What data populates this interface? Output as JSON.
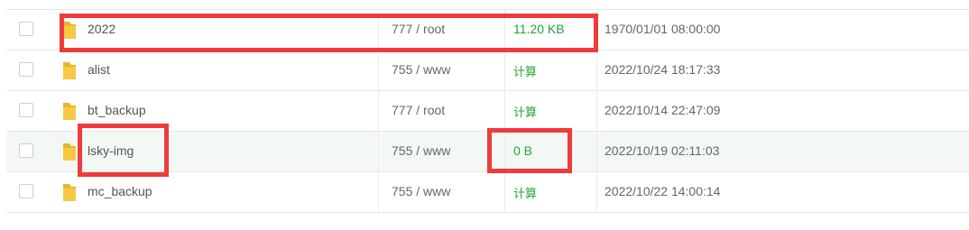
{
  "colors": {
    "size_green": "#20a53a",
    "highlight_red": "#ee3b3b",
    "folder_yellow": "#f6c945"
  },
  "rows": [
    {
      "name": "2022",
      "permission": "777 / root",
      "size": "11.20 KB",
      "modified": "1970/01/01 08:00:00"
    },
    {
      "name": "alist",
      "permission": "755 / www",
      "size": "计算",
      "modified": "2022/10/24 18:17:33"
    },
    {
      "name": "bt_backup",
      "permission": "777 / root",
      "size": "计算",
      "modified": "2022/10/14 22:47:09"
    },
    {
      "name": "lsky-img",
      "permission": "755 / www",
      "size": "0 B",
      "modified": "2022/10/19 02:11:03"
    },
    {
      "name": "mc_backup",
      "permission": "755 / www",
      "size": "计算",
      "modified": "2022/10/22 14:00:14"
    }
  ]
}
